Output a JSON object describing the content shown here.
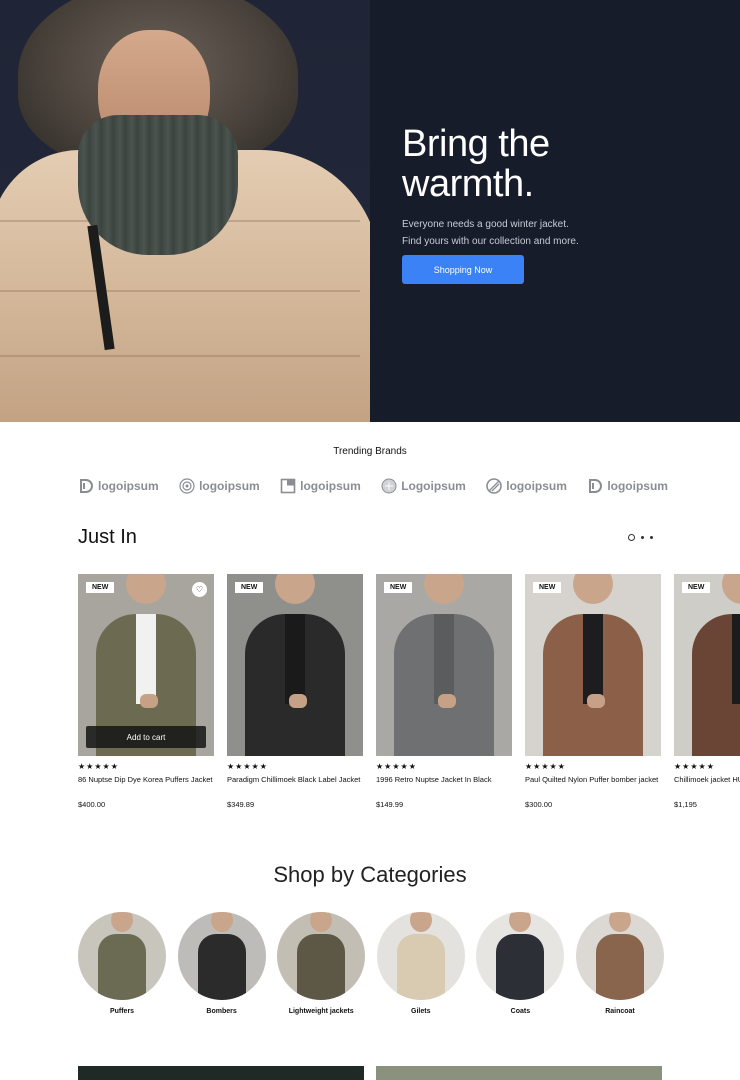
{
  "hero": {
    "title_line1": "Bring the",
    "title_line2": "warmth.",
    "subtitle_line1": "Everyone needs a good winter jacket.",
    "subtitle_line2": "Find yours with our collection and more.",
    "cta_label": "Shopping Now",
    "colors": {
      "background": "#171c2b",
      "cta": "#3b82f6"
    }
  },
  "brands": {
    "title": "Trending Brands",
    "items": [
      {
        "name": "logoipsum",
        "icon": "d-shape-icon"
      },
      {
        "name": "logoipsum",
        "icon": "spiral-icon"
      },
      {
        "name": "logoipsum",
        "icon": "square-icon"
      },
      {
        "name": "Logoipsum",
        "icon": "circle-icon"
      },
      {
        "name": "logoipsum",
        "icon": "slash-circle-icon"
      },
      {
        "name": "logoipsum",
        "icon": "d-shape-icon"
      }
    ]
  },
  "just_in": {
    "title": "Just In",
    "pager_dots": 3,
    "active_dot": 0,
    "add_to_cart_label": "Add to cart",
    "products": [
      {
        "badge": "NEW",
        "rating": "★★★★★",
        "name": "86 Nuptse Dip Dye Korea Puffers Jacket",
        "price": "$400.00",
        "color": "#6d6a52"
      },
      {
        "badge": "NEW",
        "rating": "★★★★★",
        "name": "Paradigm Chillimoek Black Label Jacket",
        "price": "$349.89",
        "color": "#2a2a2a"
      },
      {
        "badge": "NEW",
        "rating": "★★★★★",
        "name": "1996 Retro Nuptse Jacket In Black",
        "price": "$149.99",
        "color": "#6f7072"
      },
      {
        "badge": "NEW",
        "rating": "★★★★★",
        "name": "Paul Quilted Nylon Puffer bomber jacket",
        "price": "$300.00",
        "color": "#8c6048"
      },
      {
        "badge": "NEW",
        "rating": "★★★★★",
        "name": "Chillimoek jacket HUMANATURE",
        "price": "$1,195",
        "color": "#6a4434"
      }
    ]
  },
  "categories": {
    "title": "Shop by Categories",
    "items": [
      {
        "label": "Puffers",
        "color": "#6b6b54"
      },
      {
        "label": "Bombers",
        "color": "#2b2b2b"
      },
      {
        "label": "Lightweight jackets",
        "color": "#5d5746"
      },
      {
        "label": "Gilets",
        "color": "#d9cbb1"
      },
      {
        "label": "Coats",
        "color": "#2c2f36"
      },
      {
        "label": "Raincoat",
        "color": "#8a654e"
      }
    ]
  }
}
